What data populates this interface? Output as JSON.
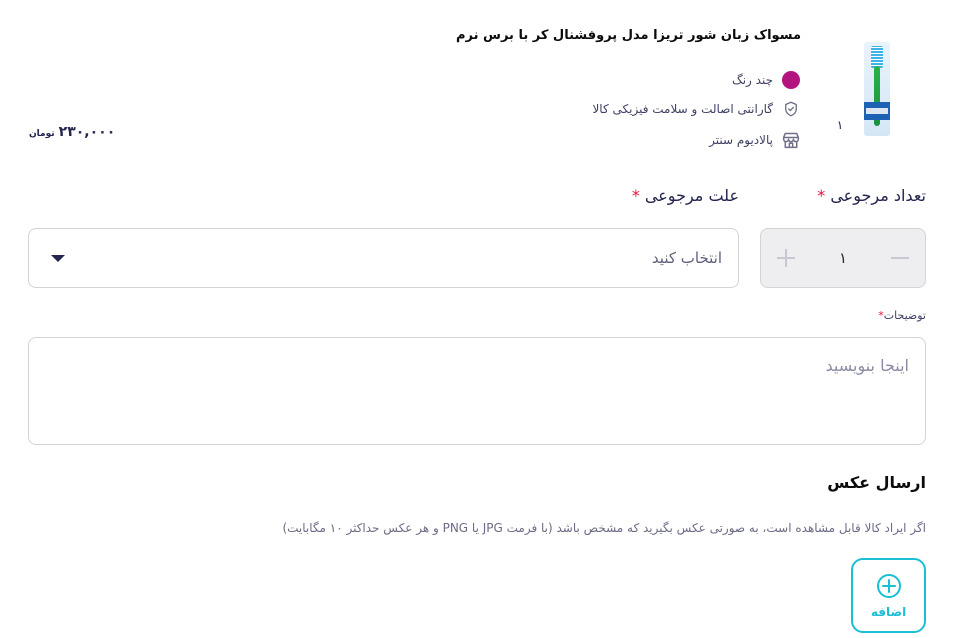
{
  "product": {
    "title": "مسواک زبان شور تریزا مدل پروفشنال کر با برس نرم",
    "quantity": "۱",
    "features": [
      {
        "icon": "color-dot-icon",
        "text": "چند رنگ"
      },
      {
        "icon": "shield-check-icon",
        "text": "گارانتی اصالت و سلامت فیزیکی کالا"
      },
      {
        "icon": "store-icon",
        "text": "پالادیوم سنتر"
      }
    ],
    "price": "۲۳۰,۰۰۰",
    "currency": "تومان",
    "color_hex": "#b3137f"
  },
  "form": {
    "return_count_label": "تعداد مرجوعی",
    "return_count_value": "۱",
    "reason_label": "علت مرجوعی",
    "reason_placeholder": "انتخاب کنید",
    "required_mark": "*",
    "description_label": "توضیحات",
    "description_placeholder": "اینجا بنویسید"
  },
  "photo": {
    "title": "ارسال عکس",
    "hint": "اگر ایراد کالا قابل مشاهده است، به صورتی عکس بگیرید که مشخص باشد (با فرمت JPG یا PNG و هر عکس حداکثر ۱۰ مگابایت)",
    "add_label": "اضافه"
  },
  "colors": {
    "accent": "#19bfd3",
    "required": "#e6123d",
    "text": "#23254e"
  }
}
